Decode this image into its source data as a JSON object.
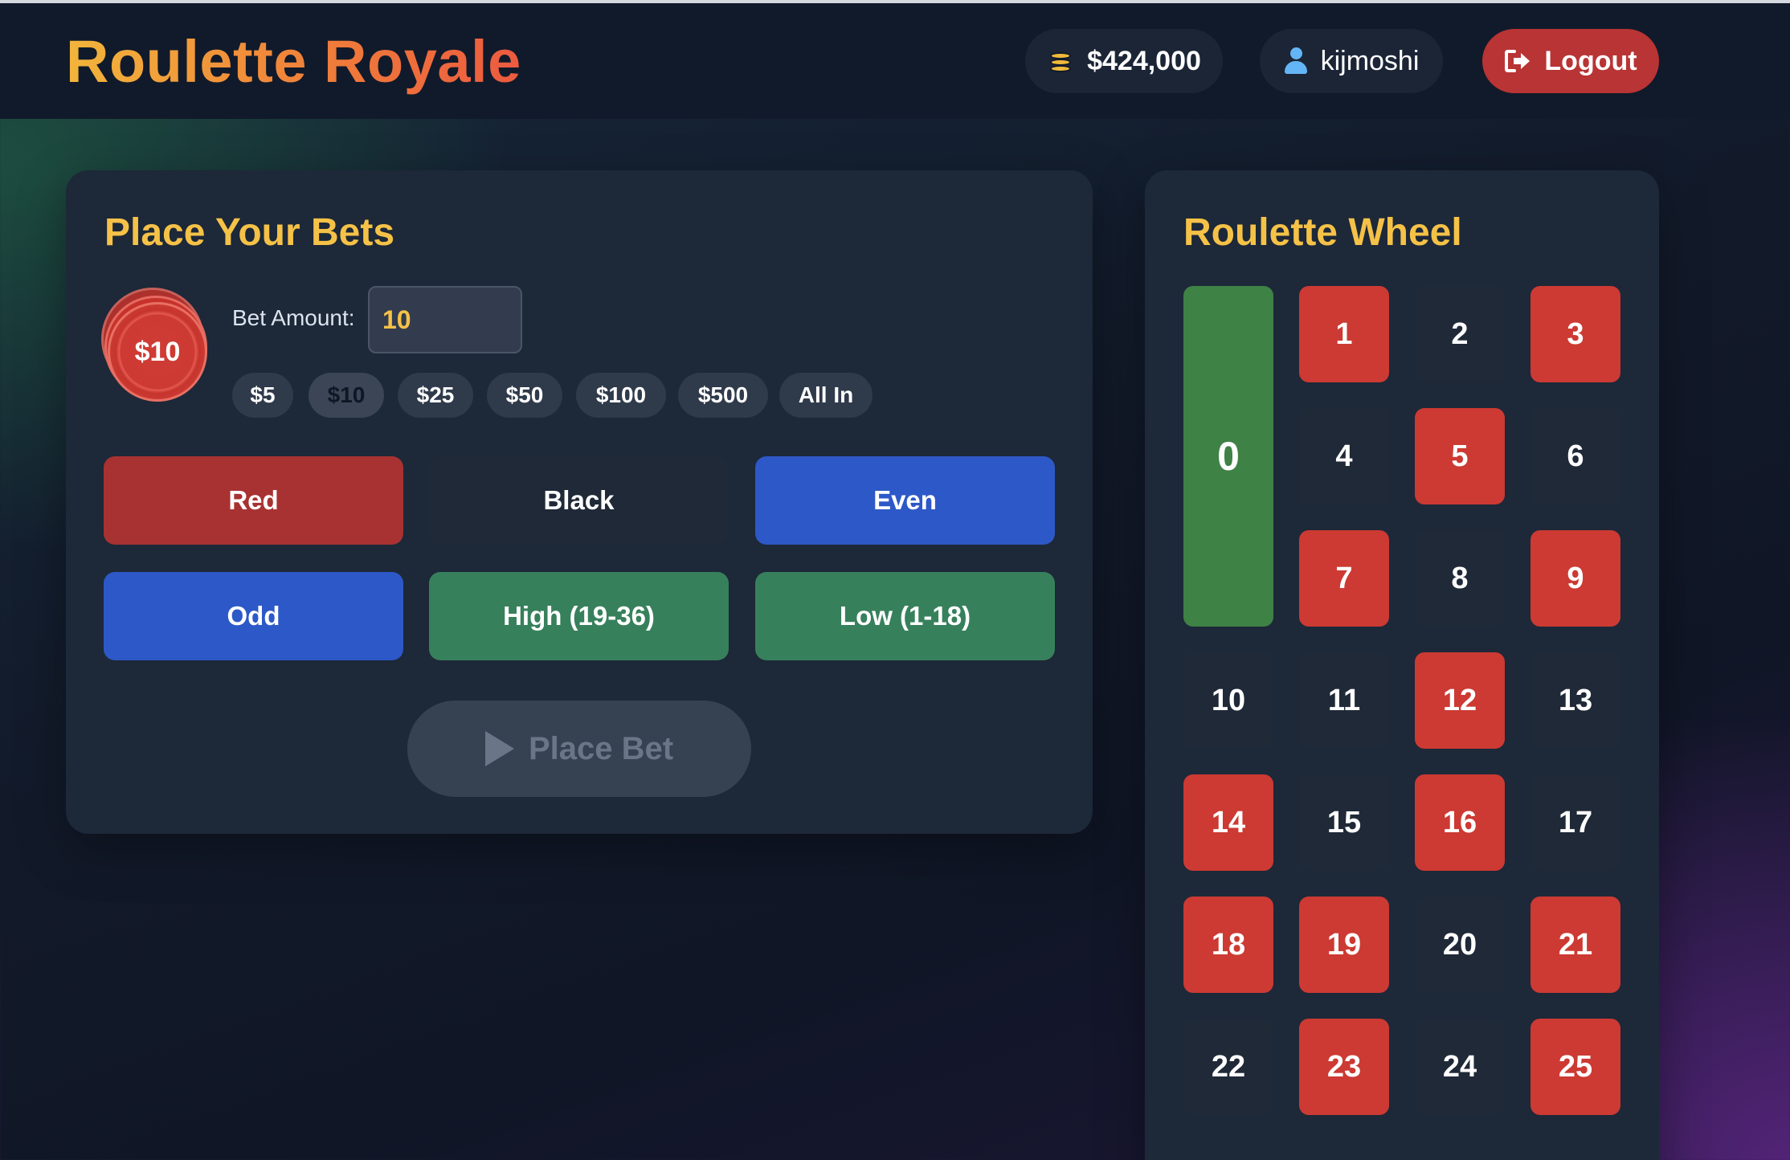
{
  "header": {
    "title": "Roulette Royale",
    "balance": "$424,000",
    "username": "kijmoshi",
    "logout_label": "Logout"
  },
  "bets": {
    "title": "Place Your Bets",
    "chip_label": "$10",
    "bet_amount_label": "Bet Amount:",
    "bet_amount_value": "10",
    "quick_amounts": [
      "$5",
      "$10",
      "$25",
      "$50",
      "$100",
      "$500",
      "All In"
    ],
    "selected_quick_amount": "$10",
    "bet_types": [
      "Red",
      "Black",
      "Even",
      "Odd",
      "High (19-36)",
      "Low (1-18)"
    ],
    "place_bet_label": "Place Bet"
  },
  "wheel": {
    "title": "Roulette Wheel",
    "zero": "0",
    "numbers": [
      {
        "n": "1",
        "color": "red"
      },
      {
        "n": "2",
        "color": "black"
      },
      {
        "n": "3",
        "color": "red"
      },
      {
        "n": "4",
        "color": "black"
      },
      {
        "n": "5",
        "color": "red"
      },
      {
        "n": "6",
        "color": "black"
      },
      {
        "n": "7",
        "color": "red"
      },
      {
        "n": "8",
        "color": "black"
      },
      {
        "n": "9",
        "color": "red"
      },
      {
        "n": "10",
        "color": "black"
      },
      {
        "n": "11",
        "color": "black"
      },
      {
        "n": "12",
        "color": "red"
      },
      {
        "n": "13",
        "color": "black"
      },
      {
        "n": "14",
        "color": "red"
      },
      {
        "n": "15",
        "color": "black"
      },
      {
        "n": "16",
        "color": "red"
      },
      {
        "n": "17",
        "color": "black"
      },
      {
        "n": "18",
        "color": "red"
      },
      {
        "n": "19",
        "color": "red"
      },
      {
        "n": "20",
        "color": "black"
      },
      {
        "n": "21",
        "color": "red"
      },
      {
        "n": "22",
        "color": "black"
      },
      {
        "n": "23",
        "color": "red"
      },
      {
        "n": "24",
        "color": "black"
      },
      {
        "n": "25",
        "color": "red"
      }
    ]
  },
  "colors": {
    "accent_gold": "#f5c247",
    "red": "#cc3a33",
    "black": "#1f2937",
    "green": "#3e8245",
    "blue": "#2d58c8"
  }
}
